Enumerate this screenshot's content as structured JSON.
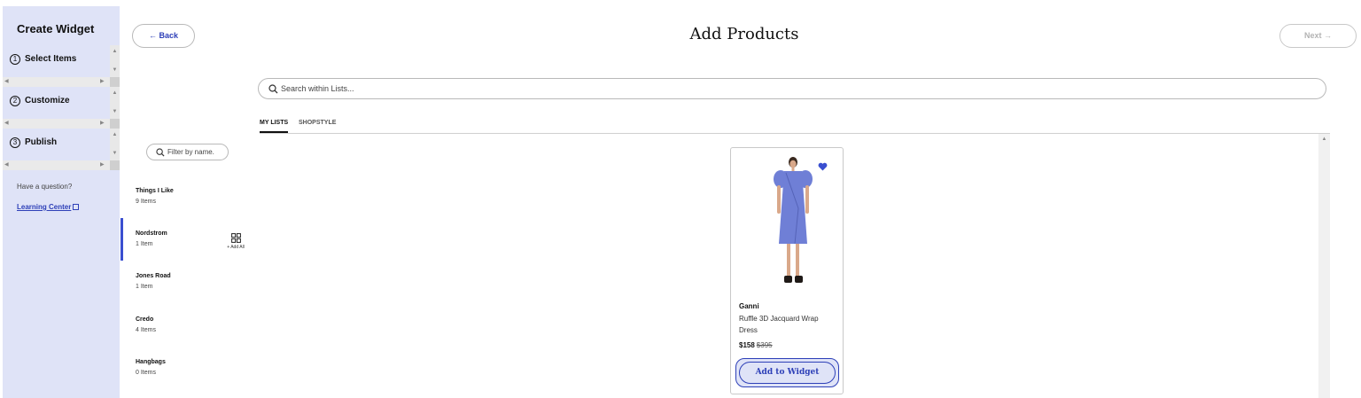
{
  "sidebar": {
    "title": "Create Widget",
    "steps": [
      {
        "number": "1",
        "label": "Select Items"
      },
      {
        "number": "2",
        "label": "Customize"
      },
      {
        "number": "3",
        "label": "Publish"
      }
    ],
    "question": "Have a question?",
    "learning_center": "Learning Center"
  },
  "header": {
    "back_label": "← Back",
    "title": "Add Products",
    "next_label": "Next →"
  },
  "search": {
    "placeholder": "Search within Lists..."
  },
  "tabs": [
    {
      "label": "MY LISTS",
      "active": true
    },
    {
      "label": "SHOPSTYLE",
      "active": false
    }
  ],
  "filter": {
    "placeholder": "Filter by name."
  },
  "lists": [
    {
      "name": "Things I Like",
      "count": "9 Items",
      "selected": false
    },
    {
      "name": "Nordstrom",
      "count": "1 Item",
      "selected": true
    },
    {
      "name": "Jones Road",
      "count": "1 Item",
      "selected": false
    },
    {
      "name": "Credo",
      "count": "4 Items",
      "selected": false
    },
    {
      "name": "Hangbags",
      "count": "0 Items",
      "selected": false
    }
  ],
  "add_all_label": "+ Add All",
  "products": [
    {
      "brand": "Ganni",
      "name": "Ruffle 3D Jacquard Wrap Dress",
      "price": "$158",
      "original_price": "$395",
      "favorited": true,
      "action_label": "Add to Widget"
    }
  ],
  "colors": {
    "accent": "#2e40b8",
    "sidebar_bg": "#dfe3f7",
    "dress": "#6f7fd6"
  }
}
